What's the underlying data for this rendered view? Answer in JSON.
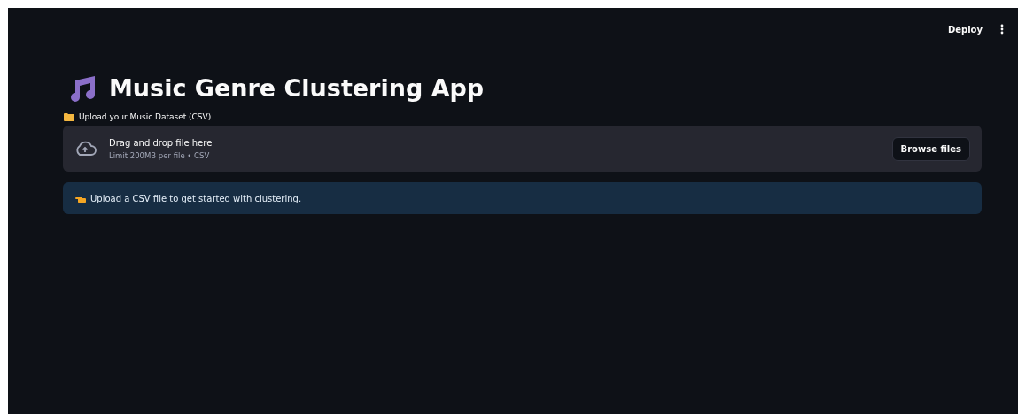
{
  "header": {
    "deploy": "Deploy"
  },
  "title": "Music Genre Clustering App",
  "uploader": {
    "label": "Upload your Music Dataset (CSV)",
    "drop_text": "Drag and drop file here",
    "limit_text": "Limit 200MB per file • CSV",
    "button": "Browse files"
  },
  "info": {
    "message": "Upload a CSV file to get started with clustering."
  }
}
